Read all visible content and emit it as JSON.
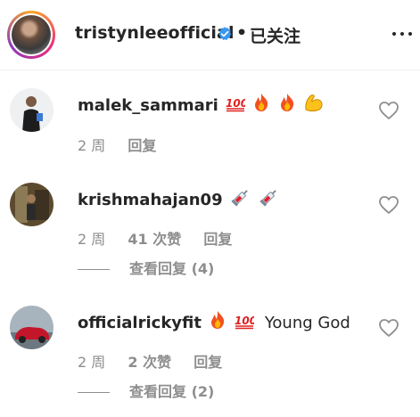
{
  "header": {
    "username": "tristynleeofficial",
    "separator": "•",
    "follow_status": "已关注",
    "verified_icon": "verified-badge-icon",
    "more_icon": "more-options-icon",
    "accent_color": "#3897f0"
  },
  "comments": [
    {
      "username": "malek_sammari",
      "text": "",
      "emojis": [
        "hundred-points",
        "fire",
        "fire",
        "flexed-biceps"
      ],
      "time": "2 周",
      "likes": "",
      "reply_label": "回复",
      "view_replies": ""
    },
    {
      "username": "krishmahajan09",
      "text": "",
      "emojis": [
        "syringe",
        "syringe"
      ],
      "time": "2 周",
      "likes": "41 次赞",
      "reply_label": "回复",
      "view_replies": "查看回复 (4)"
    },
    {
      "username": "officialrickyfit",
      "text": "Young God",
      "emojis": [
        "fire",
        "hundred-points"
      ],
      "time": "2 周",
      "likes": "2 次赞",
      "reply_label": "回复",
      "view_replies": "查看回复 (2)"
    }
  ]
}
